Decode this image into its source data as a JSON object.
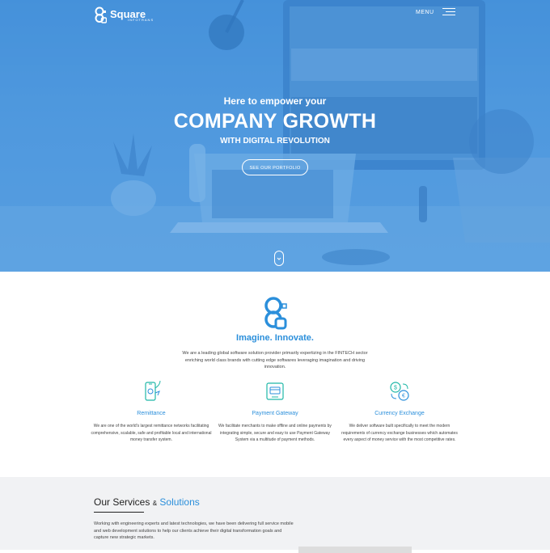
{
  "header": {
    "logo_name": "Square",
    "logo_sub": "INFOTRANS",
    "menu_label": "MENU"
  },
  "hero": {
    "kicker": "Here to empower your",
    "title": "COMPANY GROWTH",
    "subtitle": "WITH DIGITAL REVOLUTION",
    "button_label": "SEE OUR PORTFOLIO"
  },
  "intro": {
    "title": "Imagine. Innovate.",
    "description": "We are a leading global software solution provider primarily expertizing in the FINTECH sector enriching world class brands with cutting edge softwares leveraging imagination and driving innovation."
  },
  "features": [
    {
      "icon": "mobile-remittance-icon",
      "title": "Remittance",
      "description": "We are one of the world's largest remittance networks facilitating comprehensive, scalable, safe and profitable local and international money transfer system."
    },
    {
      "icon": "payment-gateway-icon",
      "title": "Payment Gateway",
      "description": "We facilitate merchants to make offline and online payments by integrating simple, secure and easy to use Payment Gateway System via a multitude of payment methods."
    },
    {
      "icon": "currency-exchange-icon",
      "title": "Currency Exchange",
      "description": "We deliver software built specifically to meet the modern requirements of currency exchange businesses which automates every aspect of money service with the most competitive rates."
    }
  ],
  "services": {
    "title_part1": "Our Services",
    "title_amp": "&",
    "title_part2": "Solutions",
    "description": "Working with engineering experts and latest technologies, we have been delivering full service mobile and web development solutions to help our clients achieve their digital transformation goals and capture new strategic markets."
  },
  "colors": {
    "brand_blue": "#2b8fdb",
    "hero_blue": "#4f97dc"
  }
}
